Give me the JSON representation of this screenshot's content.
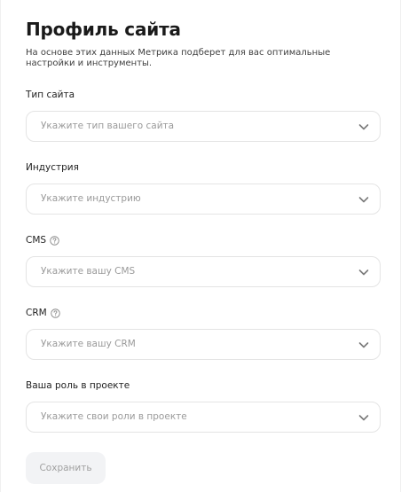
{
  "header": {
    "title": "Профиль сайта",
    "subtitle": "На основе этих данных Метрика подберет для вас оптимальные настройки и инструменты."
  },
  "fields": [
    {
      "label": "Тип сайта",
      "placeholder": "Укажите тип вашего сайта",
      "help": false
    },
    {
      "label": "Индустрия",
      "placeholder": "Укажите индустрию",
      "help": false
    },
    {
      "label": "CMS",
      "placeholder": "Укажите вашу CMS",
      "help": true
    },
    {
      "label": "CRM",
      "placeholder": "Укажите вашу CRM",
      "help": true
    },
    {
      "label": "Ваша роль в проекте",
      "placeholder": "Укажите свои роли в проекте",
      "help": false
    }
  ],
  "actions": {
    "save_label": "Сохранить",
    "save_enabled": false
  },
  "icons": {
    "help": "question-circle-icon",
    "dropdown": "chevron-down-icon"
  },
  "colors": {
    "placeholder": "#9a9a9a",
    "border": "#e4e4e4",
    "disabled_button_bg": "#f2f3f5",
    "disabled_button_text": "#a0a0a0"
  }
}
